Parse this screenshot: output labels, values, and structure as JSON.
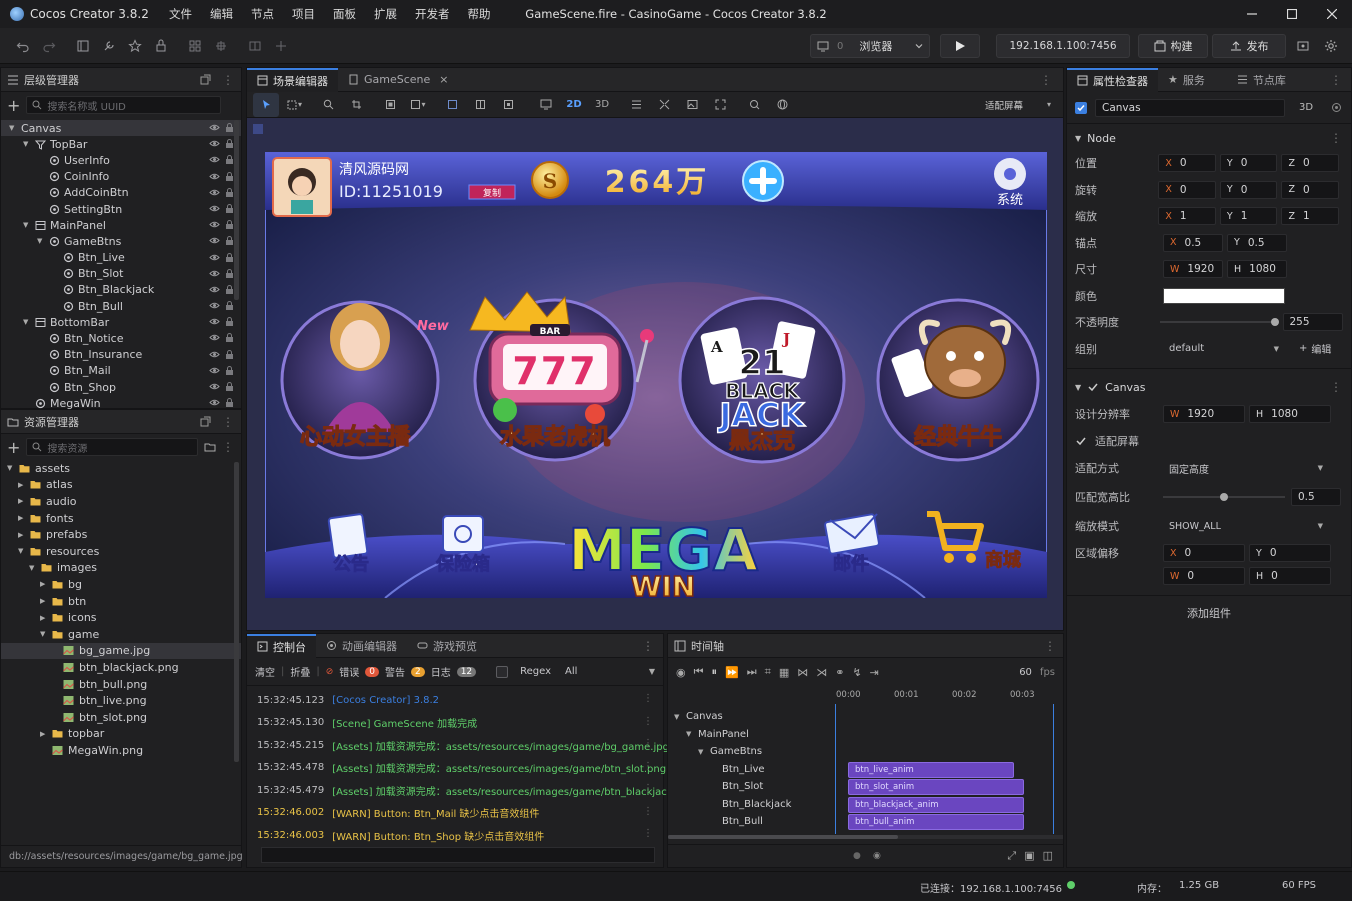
{
  "app": {
    "name": "Cocos Creator 3.8.2",
    "window_title": "GameScene.fire - CasinoGame - Cocos Creator 3.8.2"
  },
  "menus": [
    "文件",
    "编辑",
    "节点",
    "项目",
    "面板",
    "扩展",
    "开发者",
    "帮助"
  ],
  "toolbar": {
    "platform": "浏览器",
    "platform_num": "0",
    "ip": "192.168.1.100:7456",
    "build": "构建",
    "publish": "发布"
  },
  "hierarchy": {
    "title": "层级管理器",
    "search_placeholder": "搜索名称或 UUID",
    "nodes": [
      {
        "name": "Canvas",
        "depth": 0,
        "arrow": "open",
        "icon": "none"
      },
      {
        "name": "TopBar",
        "depth": 1,
        "arrow": "open",
        "icon": "filter"
      },
      {
        "name": "UserInfo",
        "depth": 2,
        "arrow": "none",
        "icon": "node"
      },
      {
        "name": "CoinInfo",
        "depth": 2,
        "arrow": "none",
        "icon": "node"
      },
      {
        "name": "AddCoinBtn",
        "depth": 2,
        "arrow": "none",
        "icon": "node"
      },
      {
        "name": "SettingBtn",
        "depth": 2,
        "arrow": "none",
        "icon": "node"
      },
      {
        "name": "MainPanel",
        "depth": 1,
        "arrow": "open",
        "icon": "panel"
      },
      {
        "name": "GameBtns",
        "depth": 2,
        "arrow": "open",
        "icon": "node"
      },
      {
        "name": "Btn_Live",
        "depth": 3,
        "arrow": "none",
        "icon": "node"
      },
      {
        "name": "Btn_Slot",
        "depth": 3,
        "arrow": "none",
        "icon": "node"
      },
      {
        "name": "Btn_Blackjack",
        "depth": 3,
        "arrow": "none",
        "icon": "node"
      },
      {
        "name": "Btn_Bull",
        "depth": 3,
        "arrow": "none",
        "icon": "node"
      },
      {
        "name": "BottomBar",
        "depth": 1,
        "arrow": "open",
        "icon": "panel"
      },
      {
        "name": "Btn_Notice",
        "depth": 2,
        "arrow": "none",
        "icon": "node"
      },
      {
        "name": "Btn_Insurance",
        "depth": 2,
        "arrow": "none",
        "icon": "node"
      },
      {
        "name": "Btn_Mail",
        "depth": 2,
        "arrow": "none",
        "icon": "node"
      },
      {
        "name": "Btn_Shop",
        "depth": 2,
        "arrow": "none",
        "icon": "node"
      },
      {
        "name": "MegaWin",
        "depth": 1,
        "arrow": "none",
        "icon": "node"
      }
    ]
  },
  "assets": {
    "title": "资源管理器",
    "search_placeholder": "搜索资源",
    "items": [
      {
        "name": "assets",
        "depth": 0,
        "arrow": "open",
        "type": "folder"
      },
      {
        "name": "atlas",
        "depth": 1,
        "arrow": "closed",
        "type": "folder"
      },
      {
        "name": "audio",
        "depth": 1,
        "arrow": "closed",
        "type": "folder"
      },
      {
        "name": "fonts",
        "depth": 1,
        "arrow": "closed",
        "type": "folder"
      },
      {
        "name": "prefabs",
        "depth": 1,
        "arrow": "closed",
        "type": "folder"
      },
      {
        "name": "resources",
        "depth": 1,
        "arrow": "open",
        "type": "folder"
      },
      {
        "name": "images",
        "depth": 2,
        "arrow": "open",
        "type": "folder"
      },
      {
        "name": "bg",
        "depth": 3,
        "arrow": "closed",
        "type": "folder"
      },
      {
        "name": "btn",
        "depth": 3,
        "arrow": "closed",
        "type": "folder"
      },
      {
        "name": "icons",
        "depth": 3,
        "arrow": "closed",
        "type": "folder"
      },
      {
        "name": "game",
        "depth": 3,
        "arrow": "open",
        "type": "folder"
      },
      {
        "name": "bg_game.jpg",
        "depth": 4,
        "arrow": "none",
        "type": "image",
        "selected": true
      },
      {
        "name": "btn_blackjack.png",
        "depth": 4,
        "arrow": "none",
        "type": "image"
      },
      {
        "name": "btn_bull.png",
        "depth": 4,
        "arrow": "none",
        "type": "image"
      },
      {
        "name": "btn_live.png",
        "depth": 4,
        "arrow": "none",
        "type": "image"
      },
      {
        "name": "btn_slot.png",
        "depth": 4,
        "arrow": "none",
        "type": "image"
      },
      {
        "name": "topbar",
        "depth": 3,
        "arrow": "closed",
        "type": "folder"
      },
      {
        "name": "MegaWin.png",
        "depth": 3,
        "arrow": "none",
        "type": "image"
      }
    ],
    "path": "db://assets/resources/images/game/bg_game.jpg"
  },
  "scene": {
    "tabs": [
      "场景编辑器",
      "GameScene"
    ],
    "mode2d": "2D",
    "mode3d": "3D",
    "fit_label": "适配屏幕",
    "game": {
      "user_name": "清风源码网",
      "user_id": "ID:11251019",
      "copy": "复制",
      "coin_symbol": "S",
      "coins": "264万",
      "settings": "系统",
      "new_badge": "New",
      "games": [
        "心动女主播",
        "水果老虎机",
        "黑杰克",
        "经典牛牛"
      ],
      "slot_bar": "BAR",
      "slot_sevens": "777",
      "blackjack_num": "21",
      "blackjack_text": [
        "BLACK",
        "JACK"
      ],
      "card_a": "A",
      "card_j": "J",
      "bottom": [
        "公告",
        "保险箱",
        "邮件",
        "商城"
      ],
      "mega": [
        "MEGA",
        "WIN"
      ]
    }
  },
  "inspector": {
    "tabs": [
      "属性检查器",
      "服务",
      "节点库"
    ],
    "node_name": "Canvas",
    "mode3d": "3D",
    "node_section": "Node",
    "props": {
      "position": {
        "label": "位置",
        "x": "0",
        "y": "0",
        "z": "0"
      },
      "rotation": {
        "label": "旋转",
        "x": "0",
        "y": "0",
        "z": "0"
      },
      "scale": {
        "label": "缩放",
        "x": "1",
        "y": "1",
        "z": "1"
      },
      "anchor": {
        "label": "锚点",
        "x": "0.5",
        "y": "0.5"
      },
      "size": {
        "label": "尺寸",
        "w": "1920",
        "h": "1080"
      },
      "color": {
        "label": "颜色",
        "value": "#FFFFFF"
      },
      "opacity": {
        "label": "不透明度",
        "value": "255",
        "fraction": 1.0
      },
      "group": {
        "label": "组别",
        "value": "default",
        "edit": "编辑"
      }
    },
    "canvas_section": "Canvas",
    "canvas": {
      "design_label": "设计分辨率",
      "design_w": "1920",
      "design_h": "1080",
      "fit_screen": "适配屏幕",
      "fit_mode_label": "适配方式",
      "fit_mode": "固定高度",
      "match_label": "匹配宽高比",
      "match": "0.5",
      "match_fraction": 0.5,
      "scale_label": "缩放模式",
      "scale_mode": "SHOW_ALL",
      "offset_label": "区域偏移",
      "ox": "0",
      "oy": "0",
      "ow": "0",
      "oh": "0"
    },
    "add_component": "添加组件"
  },
  "console": {
    "tabs": [
      "控制台",
      "动画编辑器",
      "游戏预览"
    ],
    "clear": "清空",
    "fold": "折叠",
    "error_label": "错误",
    "error_count": "0",
    "warn_label": "警告",
    "warn_count": "2",
    "log_label": "日志",
    "log_count": "12",
    "regex": "Regex",
    "filter": "All",
    "lines": [
      {
        "ts": "15:32:45.123",
        "msg": "[Cocos Creator] 3.8.2",
        "level": "info"
      },
      {
        "ts": "15:32:45.130",
        "msg": "[Scene] GameScene 加载完成",
        "level": "success"
      },
      {
        "ts": "15:32:45.215",
        "msg": "[Assets] 加载资源完成：assets/resources/images/game/bg_game.jpg",
        "level": "success"
      },
      {
        "ts": "15:32:45.478",
        "msg": "[Assets] 加载资源完成：assets/resources/images/game/btn_slot.png",
        "level": "success"
      },
      {
        "ts": "15:32:45.479",
        "msg": "[Assets] 加载资源完成：assets/resources/images/game/btn_blackjack.png",
        "level": "success"
      },
      {
        "ts": "15:32:46.002",
        "msg": "[WARN] Button: Btn_Mail 缺少点击音效组件",
        "level": "warn"
      },
      {
        "ts": "15:32:46.003",
        "msg": "[WARN] Button: Btn_Shop 缺少点击音效组件",
        "level": "warn"
      }
    ]
  },
  "timeline": {
    "title": "时间轴",
    "fps": "60",
    "fps_unit": "fps",
    "ticks": [
      "00:00",
      "00:01",
      "00:02",
      "00:03"
    ],
    "tracks": [
      {
        "name": "Canvas",
        "depth": 0,
        "clip": ""
      },
      {
        "name": "MainPanel",
        "depth": 1,
        "clip": ""
      },
      {
        "name": "GameBtns",
        "depth": 2,
        "clip": ""
      },
      {
        "name": "Btn_Live",
        "depth": 3,
        "clip": "btn_live_anim"
      },
      {
        "name": "Btn_Slot",
        "depth": 3,
        "clip": "btn_slot_anim"
      },
      {
        "name": "Btn_Blackjack",
        "depth": 3,
        "clip": "btn_blackjack_anim"
      },
      {
        "name": "Btn_Bull",
        "depth": 3,
        "clip": "btn_bull_anim"
      }
    ]
  },
  "status": {
    "connected": "已连接：192.168.1.100:7456",
    "memory_label": "内存：",
    "memory": "1.25 GB",
    "fps": "60 FPS"
  },
  "colors": {
    "accent": "#3b7fe0",
    "success": "#5fcf6a",
    "warn": "#e8c247",
    "error": "#e0573a",
    "clip": "#6a46c0"
  }
}
